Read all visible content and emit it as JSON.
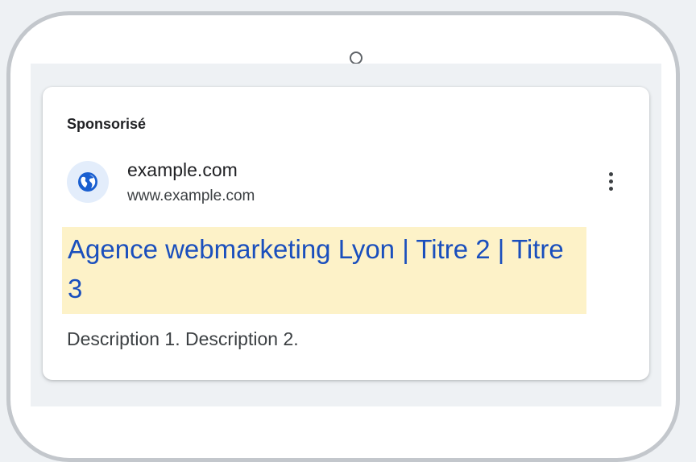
{
  "ad": {
    "sponsored_label": "Sponsorisé",
    "site_name": "example.com",
    "site_url": "www.example.com",
    "headline": "Agence webmarketing Lyon | Titre 2 | Titre 3",
    "description": "Description 1. Description 2.",
    "icons": {
      "site": "globe-icon",
      "menu": "more-vert-icon",
      "camera": "camera-icon"
    }
  },
  "colors": {
    "headline": "#1a4fbd",
    "highlight": "#fdf2c8",
    "globe": "#1a5fd0",
    "icon_bg": "#e3edfb",
    "frame": "#c3c7cc",
    "background": "#eef1f4"
  }
}
